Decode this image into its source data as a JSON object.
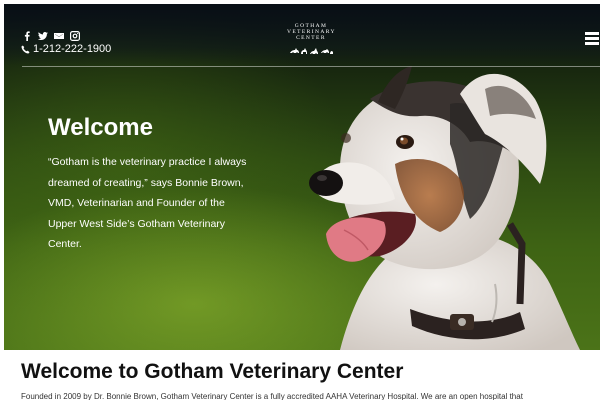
{
  "header": {
    "social_icons": [
      "facebook-icon",
      "twitter-icon",
      "email-icon",
      "instagram-icon"
    ],
    "phone": "1-212-222-1900",
    "logo": {
      "line1": "GOTHAM",
      "line2": "VETERINARY",
      "line3": "CENTER"
    }
  },
  "hero": {
    "title": "Welcome",
    "quote": "“Gotham is the veterinary practice I always dreamed of creating,” says Bonnie Brown, VMD, Veterinarian and Founder of the Upper West Side’s Gotham Veterinary Center."
  },
  "intro": {
    "title": "Welcome to Gotham Veterinary Center",
    "text": "Founded in 2009 by Dr. Bonnie Brown, Gotham Veterinary Center is a fully accredited AAHA Veterinary Hospital. We are an open hospital that"
  },
  "colors": {
    "text_on_hero": "#ffffff",
    "heading_dark": "#111111"
  }
}
